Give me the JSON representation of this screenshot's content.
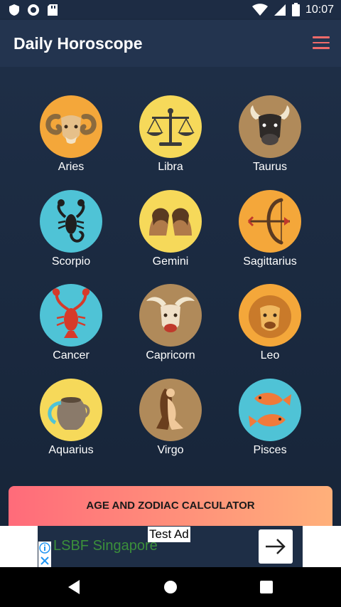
{
  "status_bar": {
    "time": "10:07"
  },
  "app_bar": {
    "title": "Daily Horoscope"
  },
  "signs": [
    {
      "label": "Aries"
    },
    {
      "label": "Libra"
    },
    {
      "label": "Taurus"
    },
    {
      "label": "Scorpio"
    },
    {
      "label": "Gemini"
    },
    {
      "label": "Sagittarius"
    },
    {
      "label": "Cancer"
    },
    {
      "label": "Capricorn"
    },
    {
      "label": "Leo"
    },
    {
      "label": "Aquarius"
    },
    {
      "label": "Virgo"
    },
    {
      "label": "Pisces"
    }
  ],
  "calculator_button": {
    "label": "AGE AND ZODIAC CALCULATOR"
  },
  "ad": {
    "tag": "Test Ad",
    "text": "LSBF Singapore"
  },
  "colors": {
    "accent": "#f06a6a",
    "background": "#1e2e46"
  }
}
